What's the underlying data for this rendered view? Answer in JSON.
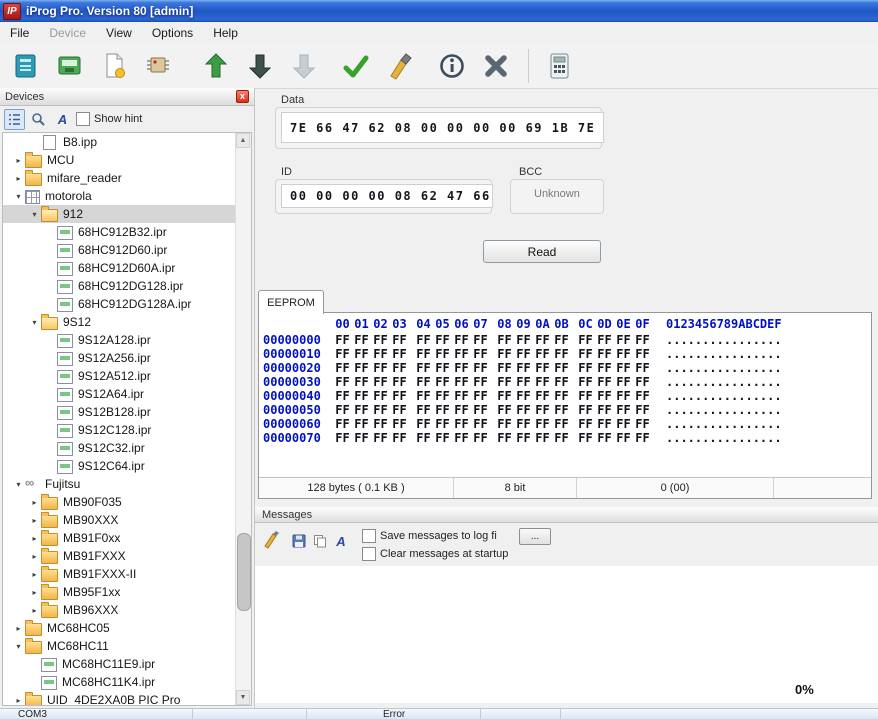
{
  "window": {
    "title": "iProg Pro. Version 80 [admin]",
    "logo_text": "IP"
  },
  "menubar": {
    "items": [
      {
        "label": "File",
        "enabled": true
      },
      {
        "label": "Device",
        "enabled": false
      },
      {
        "label": "View",
        "enabled": true
      },
      {
        "label": "Options",
        "enabled": true
      },
      {
        "label": "Help",
        "enabled": true
      }
    ]
  },
  "toolbar": {
    "icons": [
      "notebook-icon",
      "device-board-icon",
      "new-file-icon",
      "chip-icon",
      "write-up-arrow-icon",
      "read-down-arrow-icon",
      "read-down-arrow-disabled-icon",
      "verify-check-icon",
      "erase-brush-icon",
      "info-icon",
      "cancel-x-icon",
      "calculator-icon"
    ]
  },
  "icons": {
    "font_glyph": "A",
    "close_glyph": "x",
    "browse_glyph": "..."
  },
  "devices_panel": {
    "title": "Devices",
    "show_hint_label": "Show hint",
    "toolbar_icons": [
      "list-view-icon",
      "search-icon",
      "font-icon"
    ],
    "tree": [
      {
        "label": "B8.ipp",
        "depth": 2,
        "icon": "file",
        "state": null,
        "selected": false
      },
      {
        "label": "MCU",
        "depth": 1,
        "icon": "folder",
        "state": "collapsed",
        "selected": false
      },
      {
        "label": "mifare_reader",
        "depth": 1,
        "icon": "folder",
        "state": "collapsed",
        "selected": false
      },
      {
        "label": "motorola",
        "depth": 1,
        "icon": "grid",
        "state": "expanded",
        "selected": false
      },
      {
        "label": "912",
        "depth": 2,
        "icon": "folder-open",
        "state": "expanded",
        "selected": true
      },
      {
        "label": "68HC912B32.ipr",
        "depth": 3,
        "icon": "chip",
        "state": null,
        "selected": false
      },
      {
        "label": "68HC912D60.ipr",
        "depth": 3,
        "icon": "chip",
        "state": null,
        "selected": false
      },
      {
        "label": "68HC912D60A.ipr",
        "depth": 3,
        "icon": "chip",
        "state": null,
        "selected": false
      },
      {
        "label": "68HC912DG128.ipr",
        "depth": 3,
        "icon": "chip",
        "state": null,
        "selected": false
      },
      {
        "label": "68HC912DG128A.ipr",
        "depth": 3,
        "icon": "chip",
        "state": null,
        "selected": false
      },
      {
        "label": "9S12",
        "depth": 2,
        "icon": "folder-open",
        "state": "expanded",
        "selected": false
      },
      {
        "label": "9S12A128.ipr",
        "depth": 3,
        "icon": "chip",
        "state": null,
        "selected": false
      },
      {
        "label": "9S12A256.ipr",
        "depth": 3,
        "icon": "chip",
        "state": null,
        "selected": false
      },
      {
        "label": "9S12A512.ipr",
        "depth": 3,
        "icon": "chip",
        "state": null,
        "selected": false
      },
      {
        "label": "9S12A64.ipr",
        "depth": 3,
        "icon": "chip",
        "state": null,
        "selected": false
      },
      {
        "label": "9S12B128.ipr",
        "depth": 3,
        "icon": "chip",
        "state": null,
        "selected": false
      },
      {
        "label": "9S12C128.ipr",
        "depth": 3,
        "icon": "chip",
        "state": null,
        "selected": false
      },
      {
        "label": "9S12C32.ipr",
        "depth": 3,
        "icon": "chip",
        "state": null,
        "selected": false
      },
      {
        "label": "9S12C64.ipr",
        "depth": 3,
        "icon": "chip",
        "state": null,
        "selected": false
      },
      {
        "label": "Fujitsu",
        "depth": 1,
        "icon": "link",
        "state": "expanded",
        "selected": false
      },
      {
        "label": "MB90F035",
        "depth": 2,
        "icon": "folder",
        "state": "collapsed",
        "selected": false
      },
      {
        "label": "MB90XXX",
        "depth": 2,
        "icon": "folder",
        "state": "collapsed",
        "selected": false
      },
      {
        "label": "MB91F0xx",
        "depth": 2,
        "icon": "folder",
        "state": "collapsed",
        "selected": false
      },
      {
        "label": "MB91FXXX",
        "depth": 2,
        "icon": "folder",
        "state": "collapsed",
        "selected": false
      },
      {
        "label": "MB91FXXX-II",
        "depth": 2,
        "icon": "folder",
        "state": "collapsed",
        "selected": false
      },
      {
        "label": "MB95F1xx",
        "depth": 2,
        "icon": "folder",
        "state": "collapsed",
        "selected": false
      },
      {
        "label": "MB96XXX",
        "depth": 2,
        "icon": "folder",
        "state": "collapsed",
        "selected": false
      },
      {
        "label": "MC68HC05",
        "depth": 1,
        "icon": "folder",
        "state": "collapsed",
        "selected": false
      },
      {
        "label": "MC68HC11",
        "depth": 1,
        "icon": "folder",
        "state": "expanded",
        "selected": false
      },
      {
        "label": "MC68HC11E9.ipr",
        "depth": 2,
        "icon": "chip",
        "state": null,
        "selected": false
      },
      {
        "label": "MC68HC11K4.ipr",
        "depth": 2,
        "icon": "chip",
        "state": null,
        "selected": false
      },
      {
        "label": "UID_4DE2XA0B PIC Pro",
        "depth": 1,
        "icon": "folder",
        "state": "collapsed",
        "selected": false
      }
    ]
  },
  "data_group": {
    "label": "Data",
    "value": "7E 66 47 62 08 00 00 00 00 69 1B 7E"
  },
  "id_group": {
    "label": "ID",
    "value": "00 00 00 00 08 62 47 66"
  },
  "bcc_group": {
    "label": "BCC",
    "value": "Unknown"
  },
  "read_button_label": "Read",
  "eeprom": {
    "tab_label": "EEPROM",
    "columns": [
      "00",
      "01",
      "02",
      "03",
      "04",
      "05",
      "06",
      "07",
      "08",
      "09",
      "0A",
      "0B",
      "0C",
      "0D",
      "0E",
      "0F"
    ],
    "ascii_header": "0123456789ABCDEF",
    "rows": [
      {
        "address": "00000000",
        "bytes": [
          "FF",
          "FF",
          "FF",
          "FF",
          "FF",
          "FF",
          "FF",
          "FF",
          "FF",
          "FF",
          "FF",
          "FF",
          "FF",
          "FF",
          "FF",
          "FF"
        ],
        "ascii": "................"
      },
      {
        "address": "00000010",
        "bytes": [
          "FF",
          "FF",
          "FF",
          "FF",
          "FF",
          "FF",
          "FF",
          "FF",
          "FF",
          "FF",
          "FF",
          "FF",
          "FF",
          "FF",
          "FF",
          "FF"
        ],
        "ascii": "................"
      },
      {
        "address": "00000020",
        "bytes": [
          "FF",
          "FF",
          "FF",
          "FF",
          "FF",
          "FF",
          "FF",
          "FF",
          "FF",
          "FF",
          "FF",
          "FF",
          "FF",
          "FF",
          "FF",
          "FF"
        ],
        "ascii": "................"
      },
      {
        "address": "00000030",
        "bytes": [
          "FF",
          "FF",
          "FF",
          "FF",
          "FF",
          "FF",
          "FF",
          "FF",
          "FF",
          "FF",
          "FF",
          "FF",
          "FF",
          "FF",
          "FF",
          "FF"
        ],
        "ascii": "................"
      },
      {
        "address": "00000040",
        "bytes": [
          "FF",
          "FF",
          "FF",
          "FF",
          "FF",
          "FF",
          "FF",
          "FF",
          "FF",
          "FF",
          "FF",
          "FF",
          "FF",
          "FF",
          "FF",
          "FF"
        ],
        "ascii": "................"
      },
      {
        "address": "00000050",
        "bytes": [
          "FF",
          "FF",
          "FF",
          "FF",
          "FF",
          "FF",
          "FF",
          "FF",
          "FF",
          "FF",
          "FF",
          "FF",
          "FF",
          "FF",
          "FF",
          "FF"
        ],
        "ascii": "................"
      },
      {
        "address": "00000060",
        "bytes": [
          "FF",
          "FF",
          "FF",
          "FF",
          "FF",
          "FF",
          "FF",
          "FF",
          "FF",
          "FF",
          "FF",
          "FF",
          "FF",
          "FF",
          "FF",
          "FF"
        ],
        "ascii": "................"
      },
      {
        "address": "00000070",
        "bytes": [
          "FF",
          "FF",
          "FF",
          "FF",
          "FF",
          "FF",
          "FF",
          "FF",
          "FF",
          "FF",
          "FF",
          "FF",
          "FF",
          "FF",
          "FF",
          "FF"
        ],
        "ascii": "................"
      }
    ],
    "status": {
      "size": "128 bytes ( 0.1 KB )",
      "width": "8 bit",
      "position": "0 (00)"
    }
  },
  "messages": {
    "title": "Messages",
    "toolbar_icons": [
      "brush-icon",
      "save-log-icon",
      "copy-icon",
      "font-icon"
    ],
    "save_to_log_label": "Save messages to log fi",
    "browse_label": "...",
    "clear_at_startup_label": "Clear messages at startup",
    "progress": "0%"
  },
  "statusbar": {
    "port": "COM3",
    "error": "Error"
  }
}
